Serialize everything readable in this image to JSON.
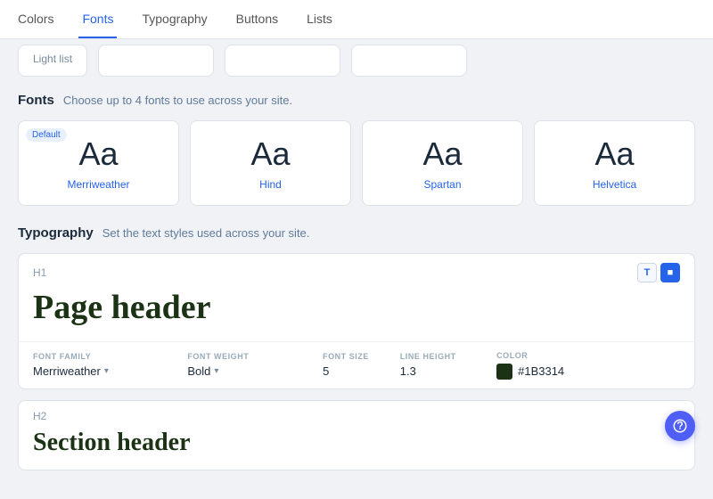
{
  "nav": {
    "tabs": [
      {
        "label": "Colors",
        "active": false
      },
      {
        "label": "Fonts",
        "active": true
      },
      {
        "label": "Typography",
        "active": false
      },
      {
        "label": "Buttons",
        "active": false
      },
      {
        "label": "Lists",
        "active": false
      }
    ]
  },
  "fonts_section": {
    "title": "Fonts",
    "description": "Choose up to 4 fonts to use across your site.",
    "default_badge": "Default",
    "cards": [
      {
        "aa": "Aa",
        "name": "Merriweather",
        "default": true
      },
      {
        "aa": "Aa",
        "name": "Hind",
        "default": false
      },
      {
        "aa": "Aa",
        "name": "Spartan",
        "default": false
      },
      {
        "aa": "Aa",
        "name": "Helvetica",
        "default": false
      }
    ]
  },
  "typography_section": {
    "title": "Typography",
    "description": "Set the text styles used across your site.",
    "h1": {
      "label": "H1",
      "preview_text": "Page header",
      "fields": {
        "font_family_label": "FONT FAMILY",
        "font_family_value": "Merriweather",
        "font_weight_label": "FONT WEIGHT",
        "font_weight_value": "Bold",
        "font_size_label": "FONT SIZE",
        "font_size_value": "5",
        "line_height_label": "LINE HEIGHT",
        "line_height_value": "1.3",
        "color_label": "COLOR",
        "color_value": "#1B3314",
        "color_display": "4183148"
      }
    },
    "h2": {
      "label": "H2",
      "preview_text": "Section header"
    }
  },
  "partial_items": [
    "Light list"
  ]
}
